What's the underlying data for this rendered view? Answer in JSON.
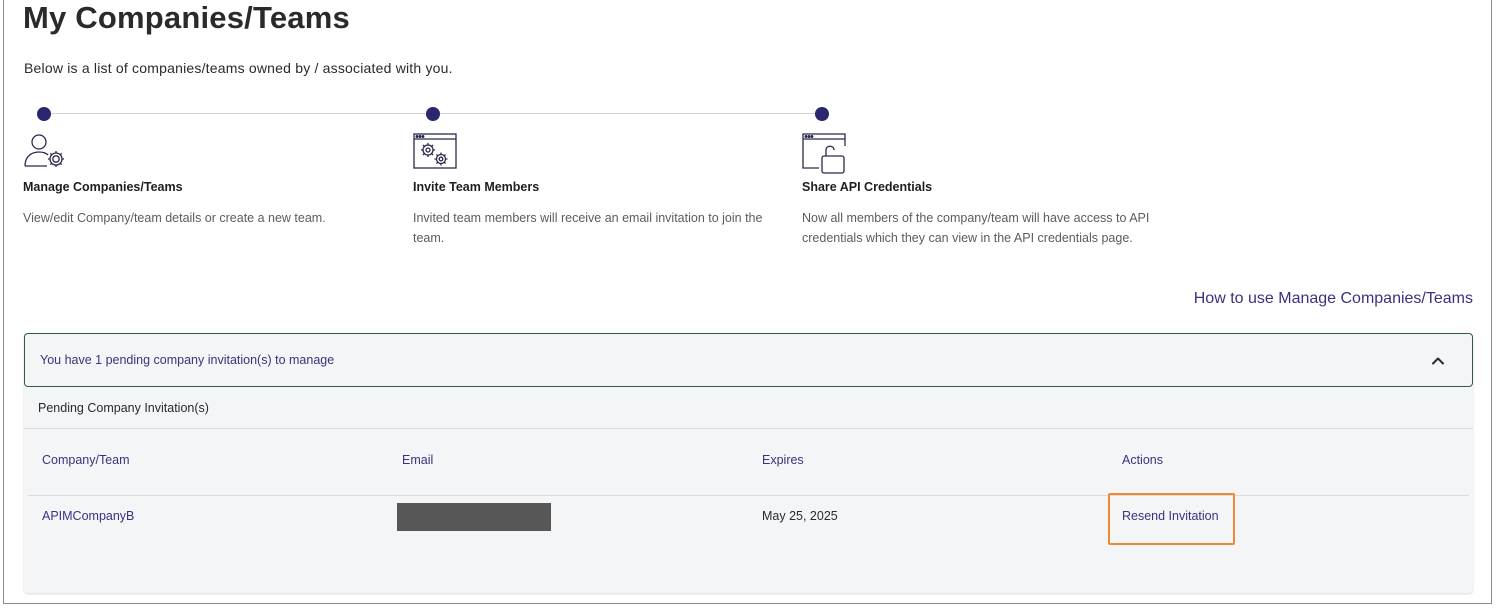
{
  "page": {
    "title": "My Companies/Teams",
    "intro": "Below is a list of companies/teams owned by / associated with you."
  },
  "steps": [
    {
      "icon": "user-gear-icon",
      "title": "Manage Companies/Teams",
      "description": "View/edit Company/team details or create a new team."
    },
    {
      "icon": "browser-gears-icon",
      "title": "Invite Team Members",
      "description": "Invited team members will receive an email invitation to join the team."
    },
    {
      "icon": "browser-unlock-icon",
      "title": "Share API Credentials",
      "description": "Now all members of the company/team will have access to API credentials which they can view in the API credentials page."
    }
  ],
  "howto_link": "How to use Manage Companies/Teams",
  "pending": {
    "header": "You have 1 pending company invitation(s) to manage",
    "expanded": true,
    "subtitle": "Pending Company Invitation(s)",
    "columns": [
      "Company/Team",
      "Email",
      "Expires",
      "Actions"
    ],
    "rows": [
      {
        "company": "APIMCompanyB",
        "email": "",
        "email_redacted": true,
        "expires": "May 25, 2025",
        "action": "Resend Invitation"
      }
    ]
  },
  "colors": {
    "accent": "#2b2670",
    "link": "#3a3280",
    "highlight": "#ef8a33",
    "accordion_border": "#2f5a52"
  }
}
